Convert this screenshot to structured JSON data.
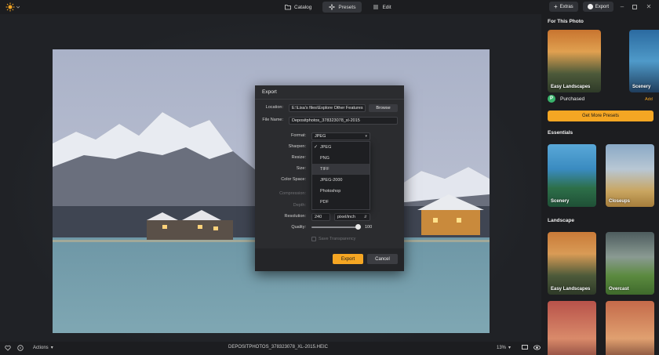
{
  "nav": {
    "catalog_label": "Catalog",
    "presets_label": "Presets",
    "edit_label": "Edit",
    "active": "Presets"
  },
  "top_right": {
    "extras_label": "Extras",
    "export_label": "Export"
  },
  "bottom_bar": {
    "actions_label": "Actions",
    "filename": "DEPOSITPHOTOS_378323078_XL-2015.HEIC",
    "zoom": "13%"
  },
  "dialog": {
    "title": "Export",
    "location_label": "Location:",
    "location_value": "E:\\Lisa's files\\Explore Other Features",
    "browse_label": "Browse",
    "filename_label": "File Name:",
    "filename_value": "Depositphotos_378323078_xl-2015",
    "format_label": "Format:",
    "format_value": "JPEG",
    "sharpen_label": "Sharpen:",
    "resize_label": "Resize:",
    "size_label": "Size:",
    "colorspace_label": "Color Space:",
    "compression_label": "Compression:",
    "depth_label": "Depth:",
    "resolution_label": "Resolution:",
    "resolution_value": "240",
    "resolution_unit": "pixel/inch",
    "quality_label": "Quality:",
    "quality_value": "100",
    "save_transparency_label": "Save Transparency",
    "export_button": "Export",
    "cancel_button": "Cancel",
    "format_options": [
      "JPEG",
      "PNG",
      "TIFF",
      "JPEG-2000",
      "Photoshop",
      "PDF"
    ],
    "selected_option": "JPEG",
    "hovered_option": "TIFF"
  },
  "panel": {
    "for_this_photo_title": "For This Photo",
    "for_this_photo_items": [
      "Easy Landscapes",
      "Scenery"
    ],
    "purchased_label": "Purchased",
    "add_label": "Add",
    "get_more_label": "Get More Presets",
    "essentials_title": "Essentials",
    "essentials_items": [
      "Scenery",
      "Closeups"
    ],
    "landscape_title": "Landscape",
    "landscape_items": [
      "Easy Landscapes",
      "Overcast"
    ]
  },
  "colors": {
    "accent": "#f5a623",
    "background": "#1c1d20",
    "dialog": "#2b2c2f"
  }
}
